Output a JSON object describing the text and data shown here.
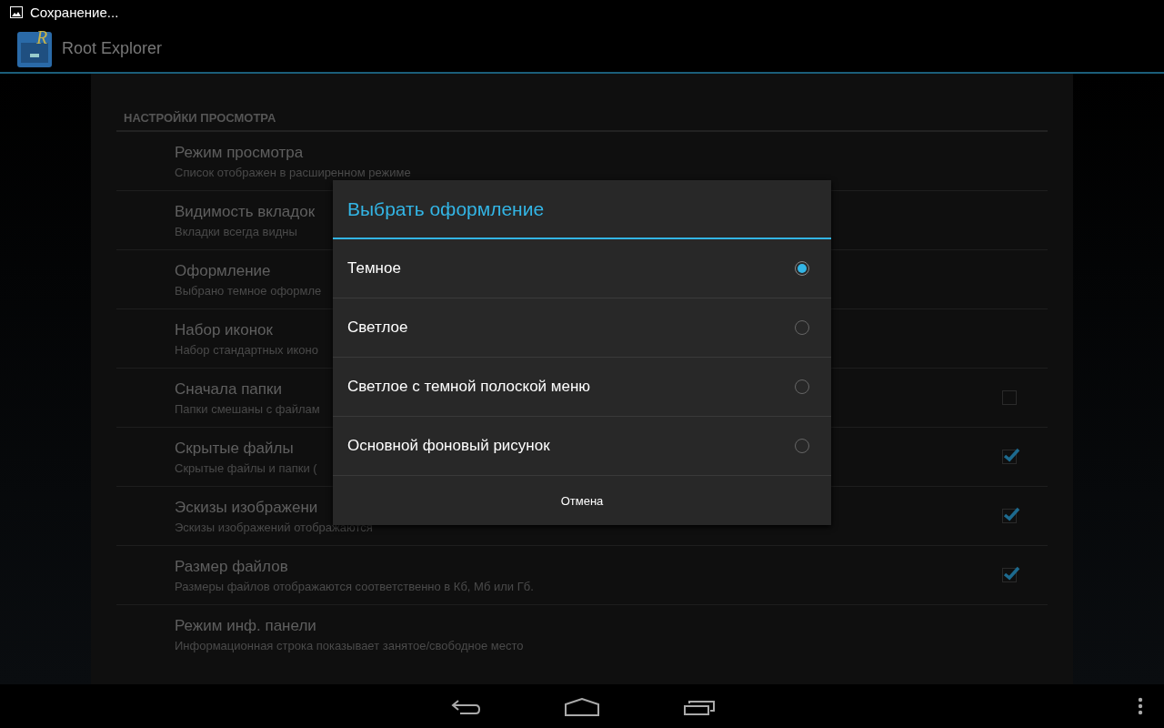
{
  "status_bar": {
    "notification": "Сохранение..."
  },
  "action_bar": {
    "logo_letter": "R",
    "title": "Root Explorer"
  },
  "settings": {
    "section": "НАСТРОЙКИ ПРОСМОТРА",
    "items": [
      {
        "kind": "plain",
        "title": "Режим просмотра",
        "summary": "Список отображен в расширенном режиме"
      },
      {
        "kind": "plain",
        "title": "Видимость вкладок",
        "summary": "Вкладки всегда видны"
      },
      {
        "kind": "plain",
        "title": "Оформление",
        "summary": "Выбрано темное оформле"
      },
      {
        "kind": "plain",
        "title": "Набор иконок",
        "summary": "Набор стандартных иконо"
      },
      {
        "kind": "checkbox",
        "title": "Сначала папки",
        "summary": "Папки смешаны с файлам",
        "checked": false
      },
      {
        "kind": "checkbox",
        "title": "Скрытые файлы",
        "summary": "Скрытые файлы и папки (",
        "checked": true
      },
      {
        "kind": "checkbox",
        "title": "Эскизы изображени",
        "summary": "Эскизы изображений отображаются",
        "checked": true
      },
      {
        "kind": "checkbox",
        "title": "Размер файлов",
        "summary": "Размеры файлов отображаются соответственно в Кб, Мб или Гб.",
        "checked": true
      },
      {
        "kind": "plain",
        "title": "Режим инф. панели",
        "summary": "Информационная строка показывает занятое/свободное место"
      }
    ]
  },
  "dialog": {
    "title": "Выбрать оформление",
    "options": [
      {
        "label": "Темное",
        "selected": true
      },
      {
        "label": "Светлое",
        "selected": false
      },
      {
        "label": "Светлое с темной полоской меню",
        "selected": false
      },
      {
        "label": "Основной фоновый рисунок",
        "selected": false
      }
    ],
    "cancel": "Отмена"
  }
}
